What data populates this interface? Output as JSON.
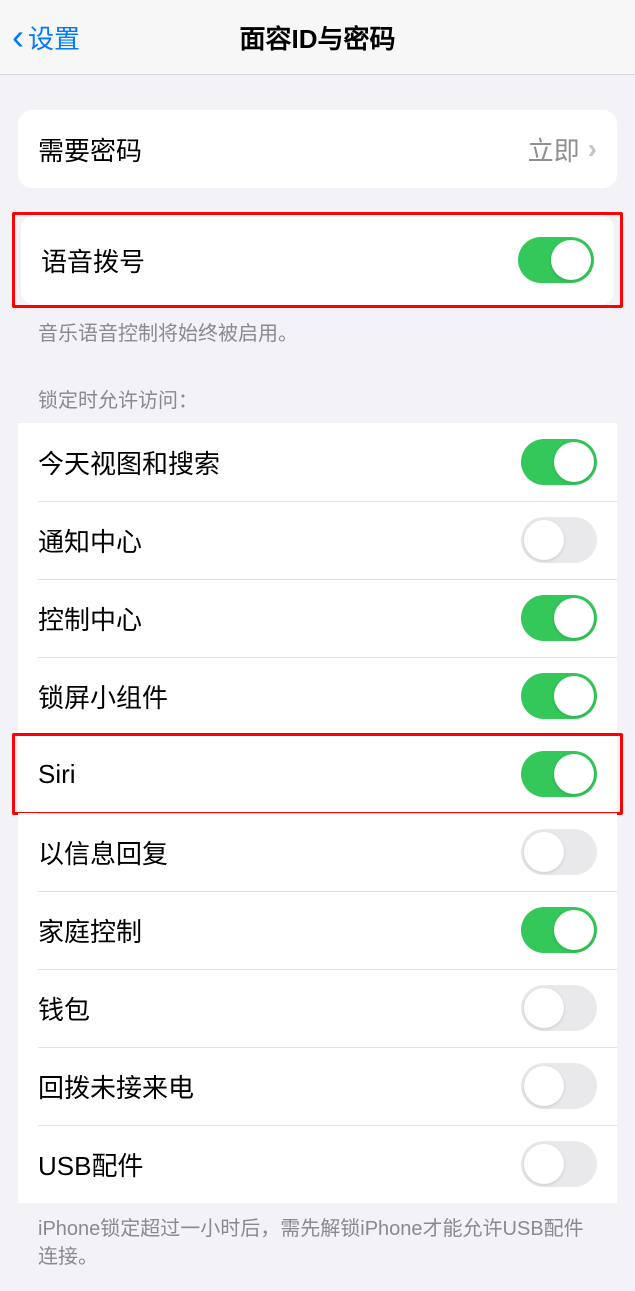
{
  "header": {
    "back_label": "设置",
    "title": "面容ID与密码"
  },
  "password_row": {
    "label": "需要密码",
    "value": "立即"
  },
  "voice_dial": {
    "label": "语音拨号",
    "footer": "音乐语音控制将始终被启用。"
  },
  "locked_section": {
    "header": "锁定时允许访问：",
    "items": [
      {
        "label": "今天视图和搜索",
        "on": true
      },
      {
        "label": "通知中心",
        "on": false
      },
      {
        "label": "控制中心",
        "on": true
      },
      {
        "label": "锁屏小组件",
        "on": true
      },
      {
        "label": "Siri",
        "on": true
      },
      {
        "label": "以信息回复",
        "on": false
      },
      {
        "label": "家庭控制",
        "on": true
      },
      {
        "label": "钱包",
        "on": false
      },
      {
        "label": "回拨未接来电",
        "on": false
      },
      {
        "label": "USB配件",
        "on": false
      }
    ],
    "footer": "iPhone锁定超过一小时后，需先解锁iPhone才能允许USB配件连接。"
  }
}
